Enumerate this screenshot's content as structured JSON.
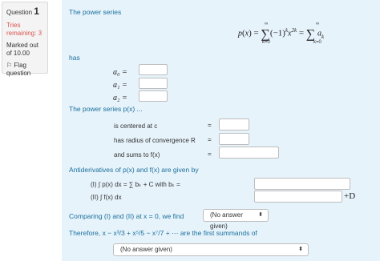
{
  "info": {
    "question_label": "Question",
    "question_number": "1",
    "tries": "Tries remaining: 3",
    "marked": "Marked out of 10.00",
    "flag_label": "Flag question",
    "flag_icon": "flag-icon"
  },
  "content": {
    "intro": "The power series",
    "formula": "p(x) = ∑ (−1)ᵏ x²ᵏ = ∑ aₖ",
    "has": "has",
    "coef_labels": [
      "a₀  =",
      "a₁  =",
      "a₂  ="
    ],
    "power_series_label": "The power series p(x) ...",
    "centered_label": "is centered at c",
    "radius_label": "has radius of convergence R",
    "sums_label": "and sums to f(x)",
    "eq_sign": "=",
    "antideriv_label": "Antiderivatives of p(x) and f(x) are given by",
    "part_I": "(I)  ∫ p(x) dx = ∑ bₖ + C  with bₖ =",
    "part_II": "(II)  ∫ f(x) dx",
    "plus_D": "+D",
    "comparing_label": "Comparing (I) and (II) at x = 0, we find",
    "therefore_label": "Therefore, x − x³/3 + x⁵/5 − x⁷/7 + ⋯ are the first summands of",
    "select1_value": "(No answer given)",
    "select2_value": "(No answer given)"
  },
  "colors": {
    "content_bg": "#e6f3fb",
    "link_blue": "#1c6f9c",
    "tries_red": "#d9534f"
  }
}
